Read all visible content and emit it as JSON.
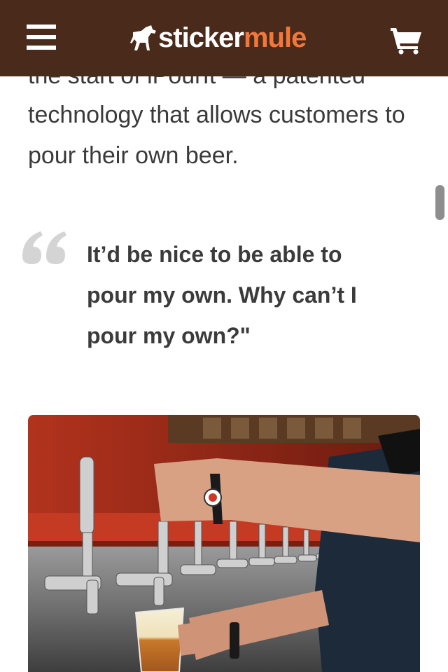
{
  "header": {
    "logo_text_1": "sticker",
    "logo_text_2": "mule",
    "menu_icon": "hamburger-menu-icon",
    "cart_icon": "shopping-cart-icon",
    "logo_icon": "mule-logo-icon",
    "background": "#4a2a1b",
    "accent": "#f2773a"
  },
  "article": {
    "clipped_line": "the start of iPourIt — a patented",
    "paragraph": "technology that allows customers to pour their own beer.",
    "quote": "It’d be nice to be able to pour my own. Why can’t I pour my own?\""
  },
  "photo": {
    "subject": "bartender-pouring-beer-photo",
    "wristband_icon": "ipourit-wristband-icon"
  }
}
